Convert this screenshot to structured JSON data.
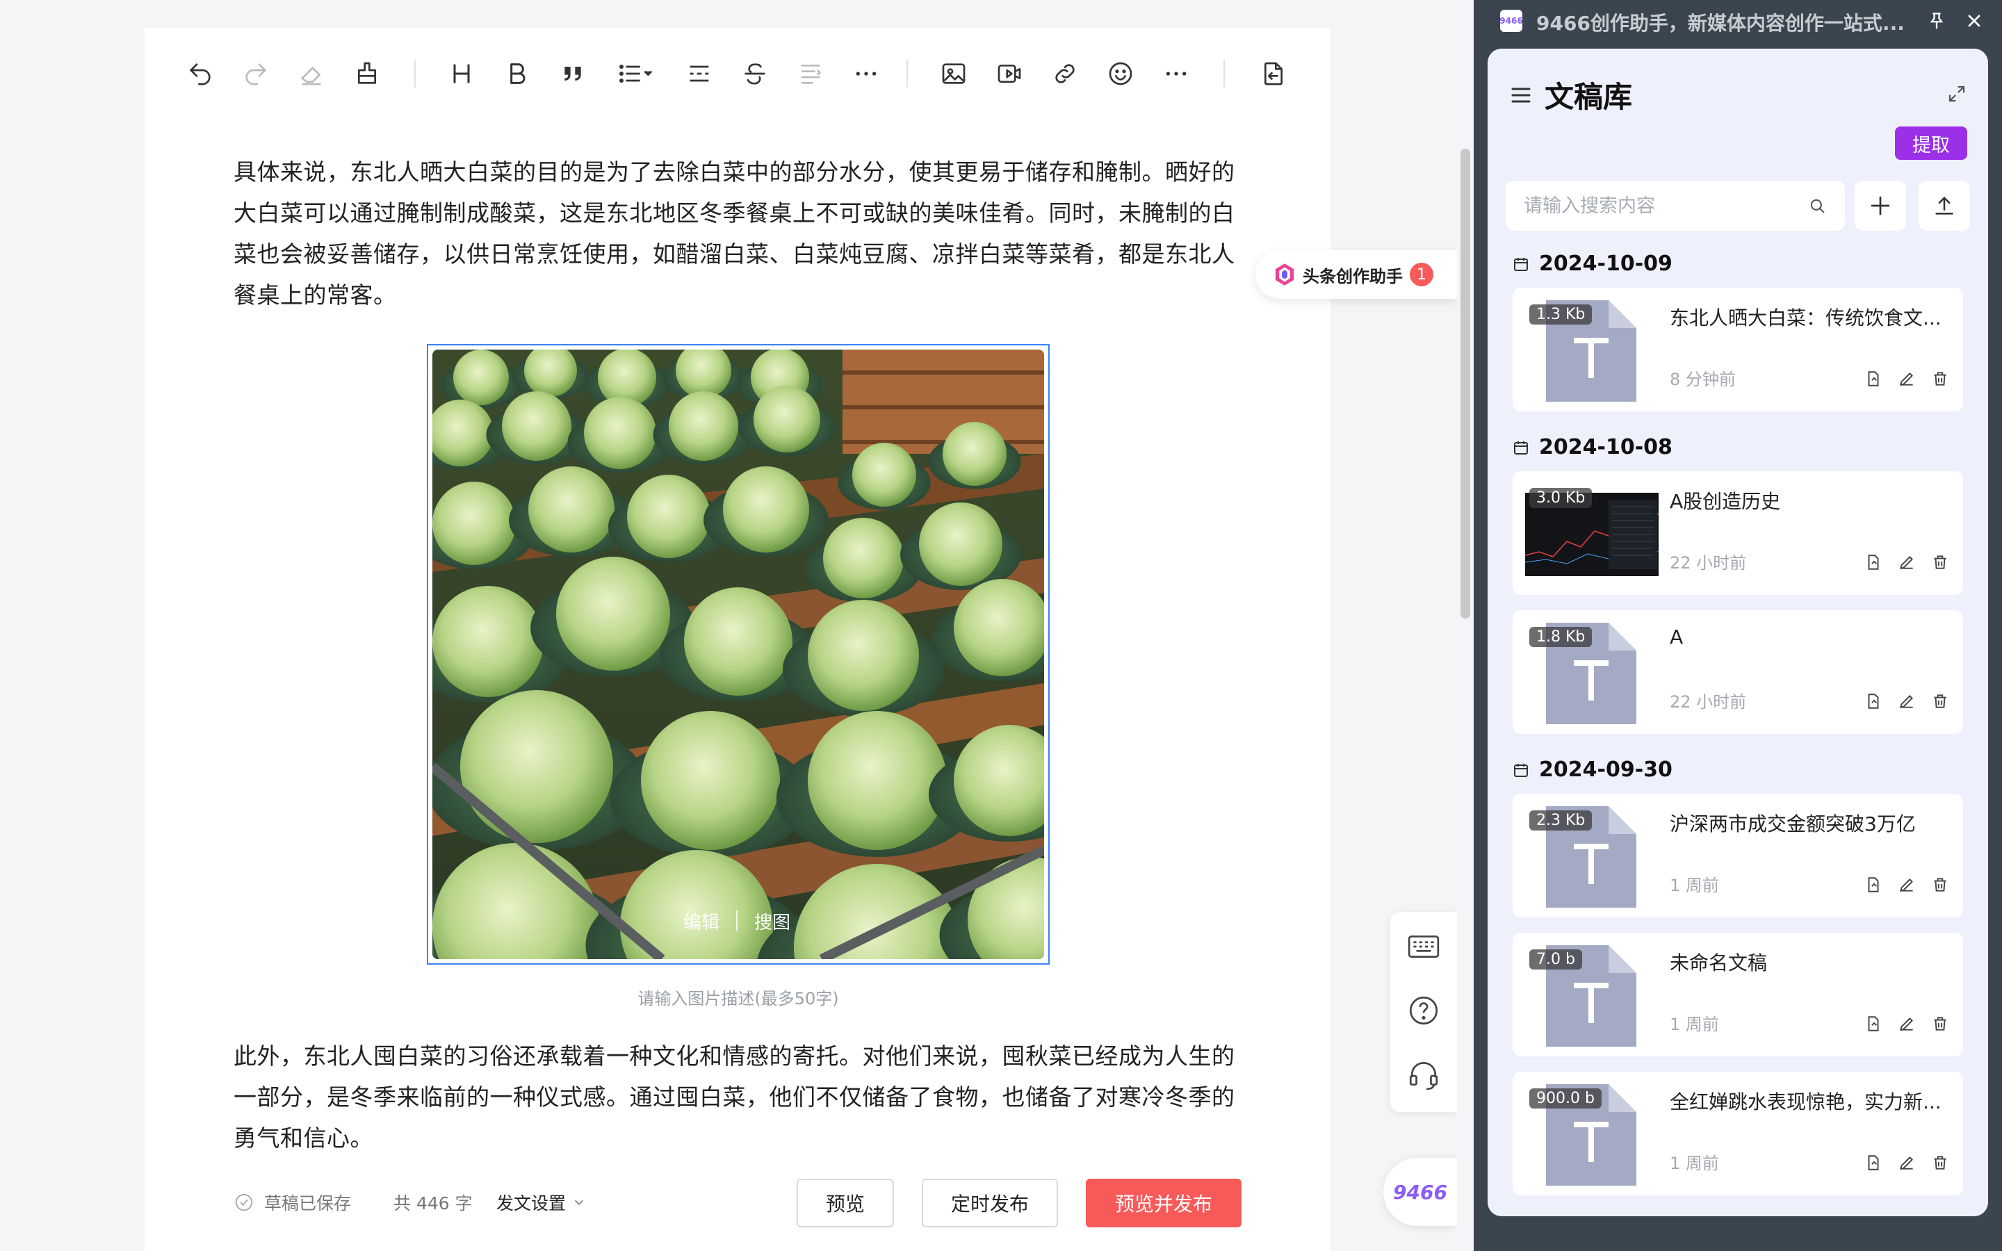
{
  "editor": {
    "para1": "具体来说，东北人晒大白菜的目的是为了去除白菜中的部分水分，使其更易于储存和腌制。晒好的大白菜可以通过腌制制成酸菜，这是东北地区冬季餐桌上不可或缺的美味佳肴。同时，未腌制的白菜也会被妥善储存，以供日常烹饪使用，如醋溜白菜、白菜炖豆腐、凉拌白菜等菜肴，都是东北人餐桌上的常客。",
    "para2": "此外，东北人囤白菜的习俗还承载着一种文化和情感的寄托。对他们来说，囤秋菜已经成为人生的一部分，是冬季来临前的一种仪式感。通过囤白菜，他们不仅储备了食物，也储备了对寒冷冬季的勇气和信心。",
    "image_edit": "编辑",
    "image_search": "搜图",
    "caption_placeholder": "请输入图片描述(最多50字)"
  },
  "bottom": {
    "saved": "草稿已保存",
    "word_count": "共 446 字",
    "publish_settings": "发文设置",
    "preview": "预览",
    "schedule": "定时发布",
    "publish": "预览并发布"
  },
  "assistant": {
    "label": "头条创作助手",
    "badge": "1"
  },
  "logo_text": "9466",
  "panel": {
    "window_title": "9466创作助手，新媒体内容创作一站式...",
    "app_icon_text": "9466",
    "title": "文稿库",
    "extract": "提取",
    "search_placeholder": "请输入搜索内容",
    "groups": [
      {
        "date": "2024-10-09"
      },
      {
        "date": "2024-10-08"
      },
      {
        "date": "2024-09-30"
      }
    ],
    "docs": [
      {
        "size": "1.3 Kb",
        "title": "东北人晒大白菜：传统饮食文...",
        "time": "8 分钟前",
        "thumb": "text"
      },
      {
        "size": "3.0 Kb",
        "title": "A股创造历史",
        "time": "22 小时前",
        "thumb": "chart"
      },
      {
        "size": "1.8 Kb",
        "title": "A",
        "time": "22 小时前",
        "thumb": "text"
      },
      {
        "size": "2.3 Kb",
        "title": "沪深两市成交金额突破3万亿",
        "time": "1 周前",
        "thumb": "text"
      },
      {
        "size": "7.0 b",
        "title": "未命名文稿",
        "time": "1 周前",
        "thumb": "text"
      },
      {
        "size": "900.0 b",
        "title": "全红婵跳水表现惊艳，实力新...",
        "time": "1 周前",
        "thumb": "text"
      }
    ]
  },
  "colors": {
    "accent": "#9b30e8",
    "publish": "#f85959",
    "panel_bg": "#3b4550",
    "selection": "#3b82f6"
  },
  "icons": {
    "toolbar": [
      "undo-icon",
      "redo-icon",
      "eraser-icon",
      "format-painter-icon",
      "heading-icon",
      "bold-icon",
      "quote-icon",
      "list-icon",
      "divider-icon",
      "strikethrough-icon",
      "indent-icon",
      "more-icon",
      "image-icon",
      "video-icon",
      "link-icon",
      "emoji-icon",
      "more-icon",
      "import-icon"
    ]
  }
}
